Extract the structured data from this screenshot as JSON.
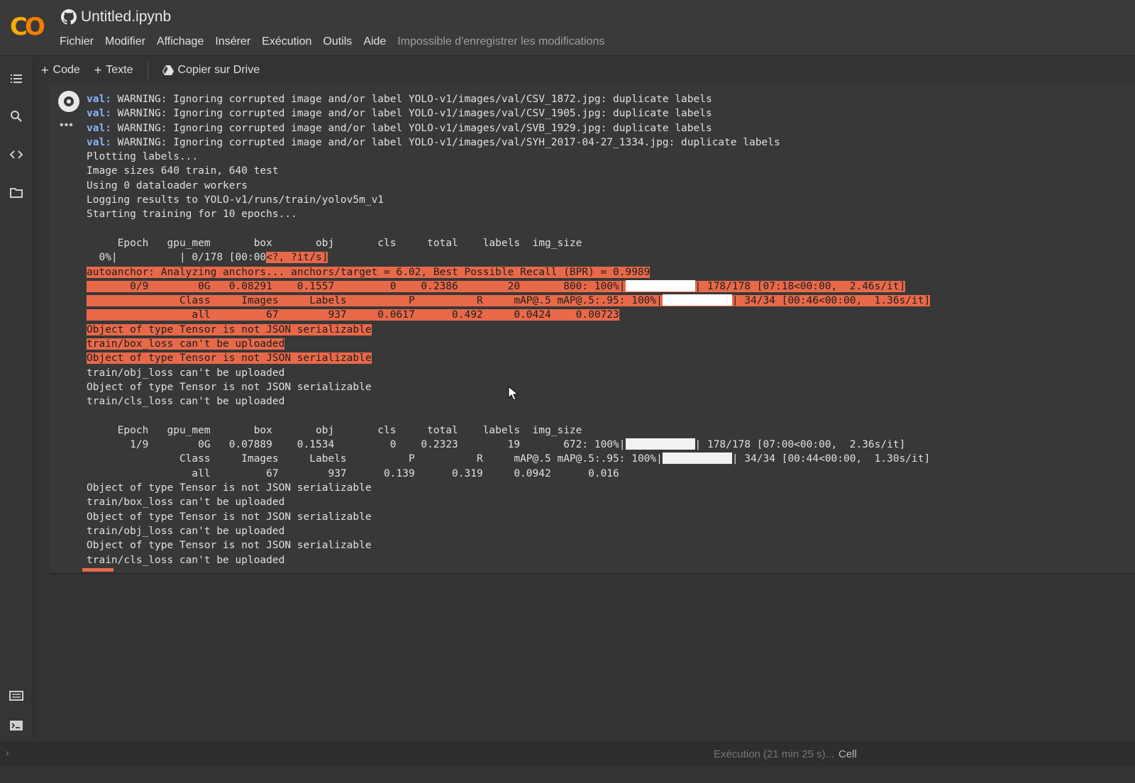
{
  "app": {
    "logo_left": "C",
    "logo_right": "O",
    "title": "Untitled.ipynb"
  },
  "menu": [
    "Fichier",
    "Modifier",
    "Affichage",
    "Insérer",
    "Exécution",
    "Outils",
    "Aide"
  ],
  "save_warning": "Impossible d'enregistrer les modifications",
  "toolbar": {
    "code_label": "Code",
    "text_label": "Texte",
    "drive_label": "Copier sur Drive"
  },
  "sidebar_icons": [
    "toc-icon",
    "search-icon",
    "code-snippets-icon",
    "folder-icon",
    "command-palette-icon",
    "terminal-icon"
  ],
  "output": {
    "lines": [
      {
        "prefix": "val:",
        "text": " WARNING: Ignoring corrupted image and/or label YOLO-v1/images/val/CSV_1872.jpg: duplicate labels"
      },
      {
        "prefix": "val:",
        "text": " WARNING: Ignoring corrupted image and/or label YOLO-v1/images/val/CSV_1905.jpg: duplicate labels"
      },
      {
        "prefix": "val:",
        "text": " WARNING: Ignoring corrupted image and/or label YOLO-v1/images/val/SVB_1929.jpg: duplicate labels"
      },
      {
        "prefix": "val:",
        "text": " WARNING: Ignoring corrupted image and/or label YOLO-v1/images/val/SYH_2017-04-27_1334.jpg: duplicate labels"
      },
      {
        "text": "Plotting labels..."
      },
      {
        "text": "Image sizes 640 train, 640 test"
      },
      {
        "text": "Using 0 dataloader workers"
      },
      {
        "text": "Logging results to YOLO-v1/runs/train/yolov5m_v1"
      },
      {
        "text": "Starting training for 10 epochs..."
      },
      {
        "text": ""
      },
      {
        "text": "     Epoch   gpu_mem       box       obj       cls     total    labels  img_size"
      },
      {
        "prefix": "  0%|          | 0/178 [00:00",
        "hl_text": "<?, ?it/s]"
      },
      {
        "hl_prefix": "autoanchor:",
        "hl_text": " Analyzing anchors... anchors/target = 6.02, Best Possible Recall (BPR) = 0.9989"
      },
      {
        "hl_text": "       0/9        0G   0.08291    0.1557         0    0.2386        20       800: 100%|",
        "bar": true,
        "hl_suffix": "| 178/178 [07:18<00:00,  2.46s/it]"
      },
      {
        "hl_text": "               Class     Images     Labels          P          R     mAP@.5 mAP@.5:.95: 100%|",
        "bar": true,
        "hl_suffix": "| 34/34 [00:46<00:00,  1.36s/it]"
      },
      {
        "hl_text": "                 all         67        937     0.0617      0.492     0.0424    0.00723"
      },
      {
        "hl_text": "Object of type Tensor is not JSON serializable"
      },
      {
        "hl_text": "train/box_loss can't be uploaded"
      },
      {
        "hl_text": "Object of type Tensor is not JSON serializable"
      },
      {
        "text": "train/obj_loss can't be uploaded"
      },
      {
        "text": "Object of type Tensor is not JSON serializable"
      },
      {
        "text": "train/cls_loss can't be uploaded"
      },
      {
        "text": ""
      },
      {
        "text": "     Epoch   gpu_mem       box       obj       cls     total    labels  img_size"
      },
      {
        "text": "       1/9        0G   0.07889    0.1534         0    0.2323        19       672: 100%|",
        "bar": true,
        "suffix": "| 178/178 [07:00<00:00,  2.36s/it]"
      },
      {
        "text": "               Class     Images     Labels          P          R     mAP@.5 mAP@.5:.95: 100%|",
        "bar": true,
        "suffix": "| 34/34 [00:44<00:00,  1.30s/it]"
      },
      {
        "text": "                 all         67        937      0.139      0.319     0.0942      0.016"
      },
      {
        "text": "Object of type Tensor is not JSON serializable"
      },
      {
        "text": "train/box_loss can't be uploaded"
      },
      {
        "text": "Object of type Tensor is not JSON serializable"
      },
      {
        "text": "train/obj_loss can't be uploaded"
      },
      {
        "text": "Object of type Tensor is not JSON serializable"
      },
      {
        "text": "train/cls_loss can't be uploaded"
      }
    ]
  },
  "status": {
    "execution": "Exécution (21 min 25 s)...",
    "cell": "Cell"
  },
  "colors": {
    "highlight": "#e8694a",
    "val_prefix": "#8ab4f8",
    "logo_yellow": "#f9ab00",
    "logo_orange": "#f57c00"
  }
}
